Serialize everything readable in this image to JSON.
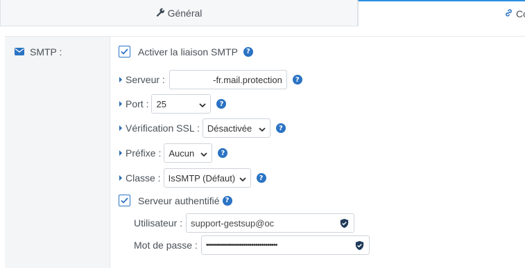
{
  "tabs": {
    "general": {
      "label": "Général",
      "icon": "wrench-icon"
    },
    "connector": {
      "label": "Co",
      "icon": "link-icon"
    }
  },
  "section": {
    "title": "SMTP :",
    "icon": "envelope-icon"
  },
  "smtp": {
    "enable_label": "Activer la liaison SMTP",
    "enable_checked": true,
    "server_label": "Serveur :",
    "server_value": "-fr.mail.protection",
    "port_label": "Port :",
    "port_value": "25",
    "ssl_label": "Vérification SSL :",
    "ssl_value": "Désactivée",
    "prefix_label": "Préfixe :",
    "prefix_value": "Aucun",
    "class_label": "Classe :",
    "class_value": "IsSMTP (Défaut)",
    "auth_label": "Serveur authentifié",
    "auth_checked": true,
    "user_label": "Utilisateur :",
    "user_value": "support-gestsup@oc",
    "pass_label": "Mot de passe :",
    "pass_value": "••••••••••••••••••••••••••••••••••••"
  },
  "colors": {
    "accent": "#2b73c4",
    "tab_active_border": "#2b8fe0"
  }
}
